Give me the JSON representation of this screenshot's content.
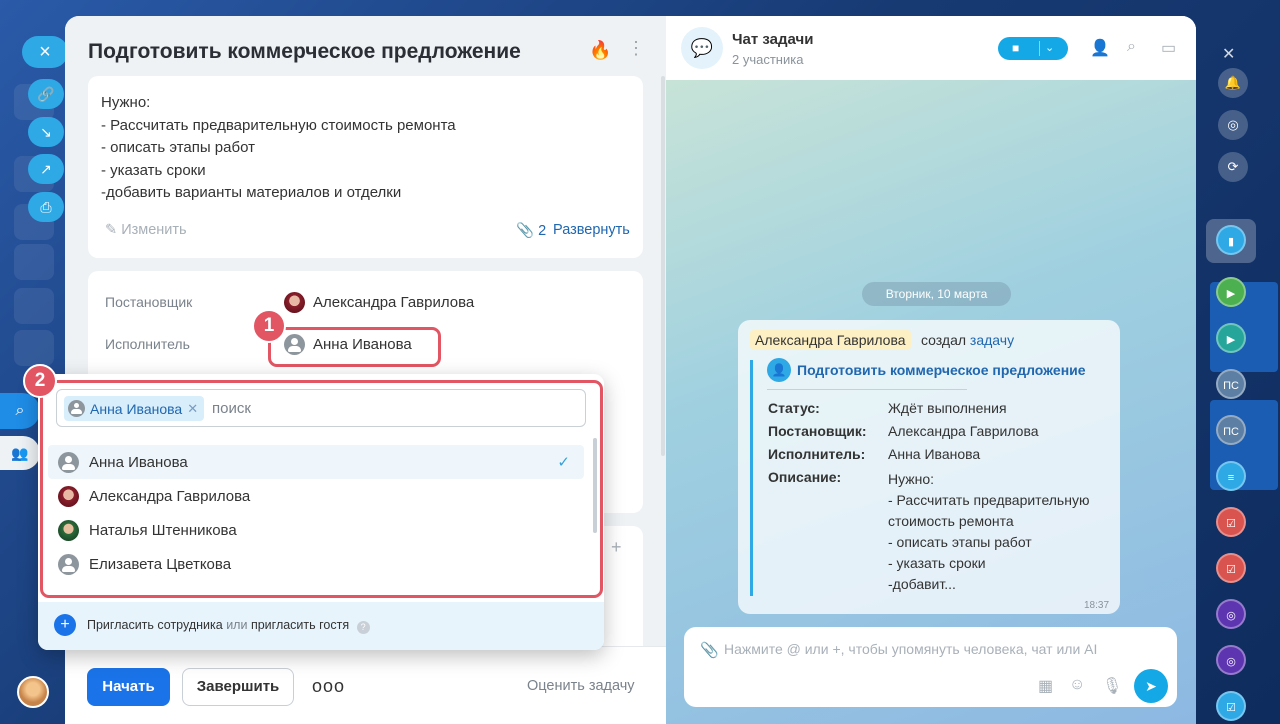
{
  "task": {
    "title": "Подготовить коммерческое предложение",
    "description_lines": [
      "Нужно:",
      "- Рассчитать предварительную стоимость ремонта",
      "- описать этапы работ",
      "- указать сроки",
      "-добавить варианты материалов и отделки"
    ],
    "edit_label": "Изменить",
    "attachments_count": "2",
    "expand_label": "Развернуть",
    "creator_label": "Постановщик",
    "creator_name": "Александра Гаврилова",
    "assignee_label": "Исполнитель",
    "assignee_name": "Анна Иванова"
  },
  "footer": {
    "start_label": "Начать",
    "finish_label": "Завершить",
    "more_label": "ooo",
    "rate_label": "Оценить задачу"
  },
  "picker": {
    "chip_label": "Анна Иванова",
    "search_placeholder": "поиск",
    "items": [
      {
        "name": "Анна Иванова",
        "selected": true
      },
      {
        "name": "Александра Гаврилова",
        "selected": false
      },
      {
        "name": "Наталья Штенникова",
        "selected": false
      },
      {
        "name": "Елизавета Цветкова",
        "selected": false
      }
    ],
    "invite_employee": "Пригласить сотрудника",
    "invite_or": "или",
    "invite_guest": "пригласить гостя"
  },
  "badges": {
    "one": "1",
    "two": "2"
  },
  "chat": {
    "title": "Чат задачи",
    "subtitle": "2 участника",
    "date": "Вторник, 10 марта",
    "message": {
      "author": "Александра Гаврилова",
      "action": "создал",
      "action_link": "задачу",
      "task_title": "Подготовить коммерческое предложение",
      "status_key": "Статус:",
      "status_value": "Ждёт выполнения",
      "creator_key": "Постановщик:",
      "creator_value": "Александра Гаврилова",
      "assignee_key": "Исполнитель:",
      "assignee_value": "Анна Иванова",
      "description_key": "Описание:",
      "description_lines": [
        "Нужно:",
        "- Рассчитать предварительную",
        "стоимость ремонта",
        "- описать этапы работ",
        "- указать сроки",
        "-добавит..."
      ],
      "time": "18:37"
    },
    "composer_placeholder": "Нажмите @ или +, чтобы упомянуть человека, чат или AI"
  },
  "right_rail": {
    "chat_initials_1": "ПС",
    "chat_initials_2": "ПС"
  },
  "colors": {
    "accent": "#1a73e8",
    "highlight": "#e25563",
    "chat_accent": "#14a8e6"
  }
}
